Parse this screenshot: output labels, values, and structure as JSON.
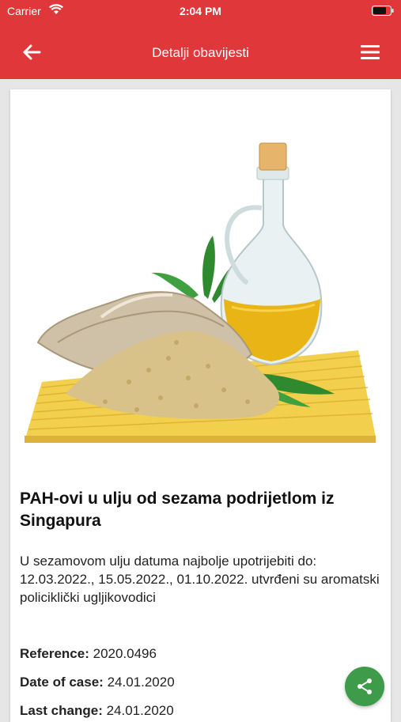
{
  "status_bar": {
    "carrier": "Carrier",
    "time": "2:04 PM"
  },
  "nav": {
    "title": "Detalji obavijesti"
  },
  "notice": {
    "title": "PAH-ovi u ulju od sezama podrijetlom iz Singapura",
    "description": "U sezamovom ulju datuma najbolje upotrijebiti do: 12.03.2022., 15.05.2022., 01.10.2022. utvrđeni su aromatski policiklički ugljikovodici",
    "reference_label": "Reference:",
    "reference_value": "2020.0496",
    "date_label": "Date of case:",
    "date_value": "24.01.2020",
    "last_change_label": "Last change:",
    "last_change_value": "24.01.2020"
  },
  "colors": {
    "header": "#e0373a",
    "share_button": "#3d9b4a"
  },
  "icons": {
    "back": "arrow-left-icon",
    "menu": "hamburger-menu-icon",
    "share": "share-icon"
  }
}
